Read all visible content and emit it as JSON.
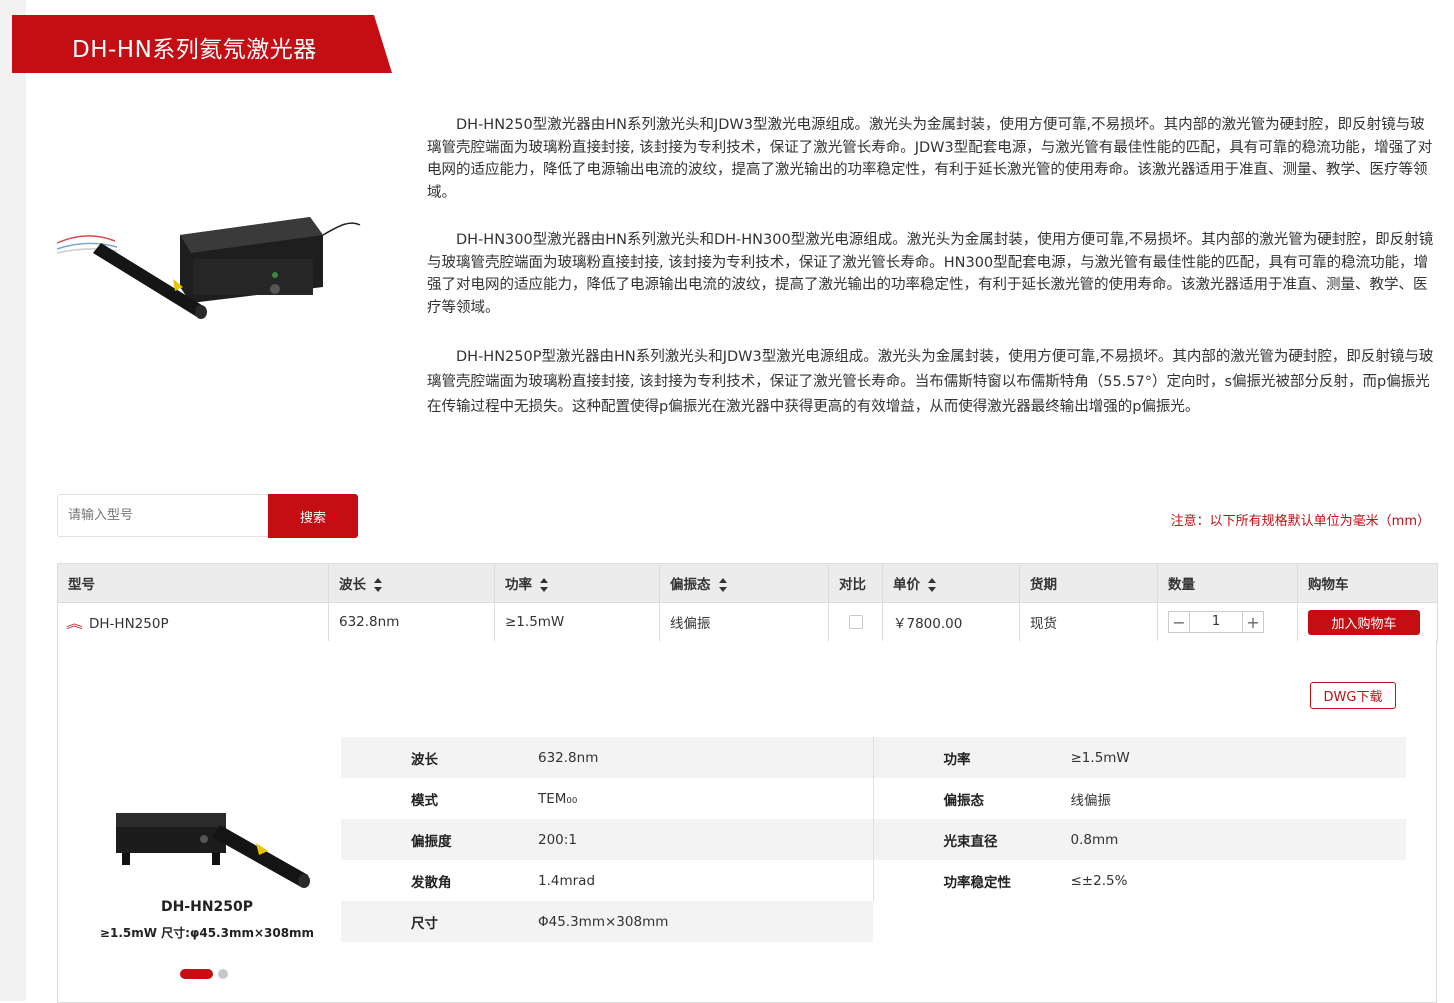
{
  "page": {
    "title": "DH-HN系列氦氖激光器",
    "descriptions": [
      "DH-HN250型激光器由HN系列激光头和JDW3型激光电源组成。激光头为金属封装，使用方便可靠,不易损坏。其内部的激光管为硬封腔，即反射镜与玻璃管壳腔端面为玻璃粉直接封接, 该封接为专利技术，保证了激光管长寿命。JDW3型配套电源，与激光管有最佳性能的匹配，具有可靠的稳流功能，增强了对电网的适应能力，降低了电源输出电流的波纹，提高了激光输出的功率稳定性，有利于延长激光管的使用寿命。该激光器适用于准直、测量、教学、医疗等领域。",
      "DH-HN300型激光器由HN系列激光头和DH-HN300型激光电源组成。激光头为金属封装，使用方便可靠,不易损坏。其内部的激光管为硬封腔，即反射镜与玻璃管壳腔端面为玻璃粉直接封接, 该封接为专利技术，保证了激光管长寿命。HN300型配套电源，与激光管有最佳性能的匹配，具有可靠的稳流功能，增强了对电网的适应能力，降低了电源输出电流的波纹，提高了激光输出的功率稳定性，有利于延长激光管的使用寿命。该激光器适用于准直、测量、教学、医疗等领域。",
      "DH-HN250P型激光器由HN系列激光头和JDW3型激光电源组成。激光头为金属封装，使用方便可靠,不易损坏。其内部的激光管为硬封腔，即反射镜与玻璃管壳腔端面为玻璃粉直接封接, 该封接为专利技术，保证了激光管长寿命。当布儒斯特窗以布儒斯特角（55.57°）定向时，s偏振光被部分反射，而p偏振光在传输过程中无损失。这种配置使得p偏振光在激光器中获得更高的有效增益，从而使得激光器最终输出增强的p偏振光。"
    ]
  },
  "search": {
    "placeholder": "请输入型号",
    "button_label": "搜索"
  },
  "note": "注意：以下所有规格默认单位为毫米（mm）",
  "table": {
    "headers": [
      "型号",
      "波长",
      "功率",
      "偏振态",
      "对比",
      "单价",
      "货期",
      "数量",
      "购物车"
    ],
    "row": {
      "model": "DH-HN250P",
      "wavelength": "632.8nm",
      "power": "≥1.5mW",
      "polarization": "线偏振",
      "price": "￥7800.00",
      "delivery": "现货",
      "quantity": "1",
      "cart_label": "加入购物车",
      "minus": "−",
      "plus": "+"
    }
  },
  "detail": {
    "dwg_label": "DWG下载",
    "product_name": "DH-HN250P",
    "product_sub": "≥1.5mW  尺寸:φ45.3mm×308mm",
    "specs": [
      {
        "label": "波长",
        "value": "632.8nm"
      },
      {
        "label": "功率",
        "value": "≥1.5mW"
      },
      {
        "label": "模式",
        "value": "TEM₀₀"
      },
      {
        "label": "偏振态",
        "value": "线偏振"
      },
      {
        "label": "偏振度",
        "value": "200:1"
      },
      {
        "label": "光束直径",
        "value": "0.8mm"
      },
      {
        "label": "发散角",
        "value": "1.4mrad"
      },
      {
        "label": "功率稳定性",
        "value": "≤±2.5%"
      },
      {
        "label": "尺寸",
        "value": "Φ45.3mm×308mm"
      }
    ],
    "carousel": {
      "active_index": 0,
      "count": 2
    }
  },
  "colors": {
    "accent": "#c40e14",
    "header_bg": "#ececec",
    "spec_shade": "#f3f3f3"
  }
}
